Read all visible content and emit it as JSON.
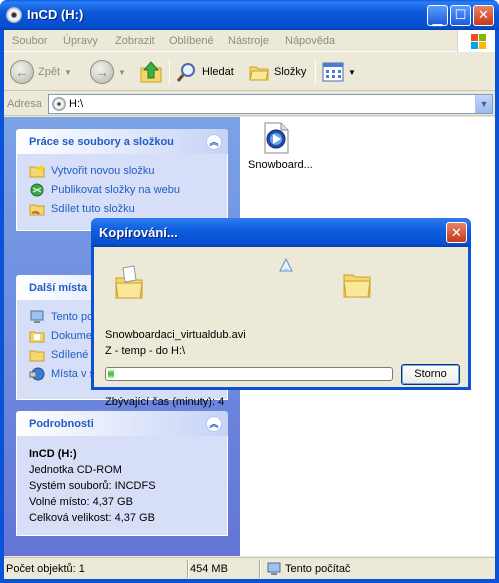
{
  "window": {
    "title": "InCD (H:)"
  },
  "menu": [
    "Soubor",
    "Úpravy",
    "Zobrazit",
    "Oblíbené",
    "Nástroje",
    "Nápověda"
  ],
  "toolbar": {
    "back_label": "Zpět",
    "search_label": "Hledat",
    "folders_label": "Složky"
  },
  "address": {
    "label": "Adresa",
    "value": "H:\\"
  },
  "tasks_panel": {
    "title": "Práce se soubory a složkou",
    "items": [
      "Vytvořit novou složku",
      "Publikovat složky na webu",
      "Sdílet tuto složku"
    ]
  },
  "places_panel": {
    "title": "Další místa",
    "items": [
      "Tento počítač",
      "Dokumenty",
      "Sdílené dokumenty",
      "Místa v síti"
    ]
  },
  "details_panel": {
    "title": "Podrobnosti",
    "name": "InCD (H:)",
    "type": "Jednotka CD-ROM",
    "filesystem": "Systém souborů: INCDFS",
    "free": "Volné místo: 4,37 GB",
    "total": "Celková velikost: 4,37 GB"
  },
  "files": [
    {
      "label": "Snowboard...",
      "icon": "video-file-icon"
    }
  ],
  "status": {
    "count": "Počet objektů: 1",
    "size": "454 MB",
    "location": "Tento počítač"
  },
  "copy_dialog": {
    "title": "Kopírování...",
    "filename": "Snowboardaci_virtualdub.avi",
    "route": "Z - temp - do H:\\",
    "progress_fraction": 0.04,
    "cancel_label": "Storno",
    "time_remaining": "Zbývající čas (minuty): 4"
  }
}
